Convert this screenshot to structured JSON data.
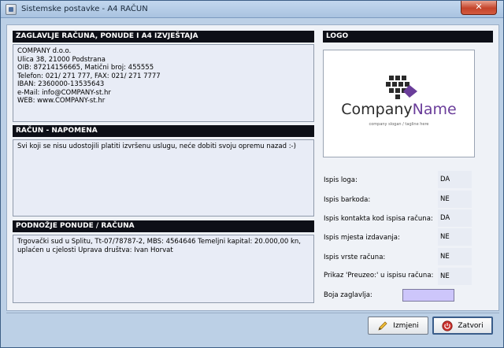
{
  "window": {
    "title": "Sistemske postavke - A4 RAČUN",
    "close_label": "✕"
  },
  "header_section": {
    "title": "ZAGLAVLJE RAČUNA, PONUDE I  A4  IZVJEŠTAJA",
    "text": "COMPANY d.o.o.\nUlica 38, 21000 Podstrana\nOIB: 87214156665, Matični broj: 455555\nTelefon: 021/ 271 777, FAX: 021/ 271 7777\nIBAN: 2360000-13535643\ne-Mail: info@COMPANY-st.hr\nWEB: www.COMPANY-st.hr"
  },
  "note_section": {
    "title": "RAČUN - NAPOMENA",
    "text": "Svi koji se nisu udostojili platiti izvršenu uslugu, neće dobiti svoju opremu nazad :-)"
  },
  "footer_section": {
    "title": "PODNOŽJE PONUDE / RAČUNA",
    "text": "Trgovački sud u Splitu, Tt-07/78787-2, MBS: 4564646  Temeljni kapital: 20.000,00 kn,\nuplaćen u cjelosti Uprava društva: Ivan Horvat"
  },
  "logo_section": {
    "title": "LOGO",
    "brand_company": "Company",
    "brand_name": "Name",
    "brand_slogan": "company slogan / tagline here"
  },
  "settings": [
    {
      "label": "Ispis loga:",
      "value": "DA"
    },
    {
      "label": "Ispis barkoda:",
      "value": "NE"
    },
    {
      "label": "Ispis kontakta kod ispisa računa:",
      "value": "DA"
    },
    {
      "label": "Ispis mjesta izdavanja:",
      "value": "NE"
    },
    {
      "label": "Ispis vrste računa:",
      "value": "NE"
    },
    {
      "label": "Prikaz 'Preuzeo:' u ispisu računa:",
      "value": "NE"
    }
  ],
  "header_color": {
    "label": "Boja zaglavlja:",
    "value": "#cdc6fb"
  },
  "buttons": {
    "edit_label": "Izmjeni",
    "close_label": "Zatvori"
  },
  "icons": {
    "edit": "pencil-icon",
    "close": "power-icon",
    "app": "app-icon",
    "logo": "checker-diamond-icon"
  }
}
